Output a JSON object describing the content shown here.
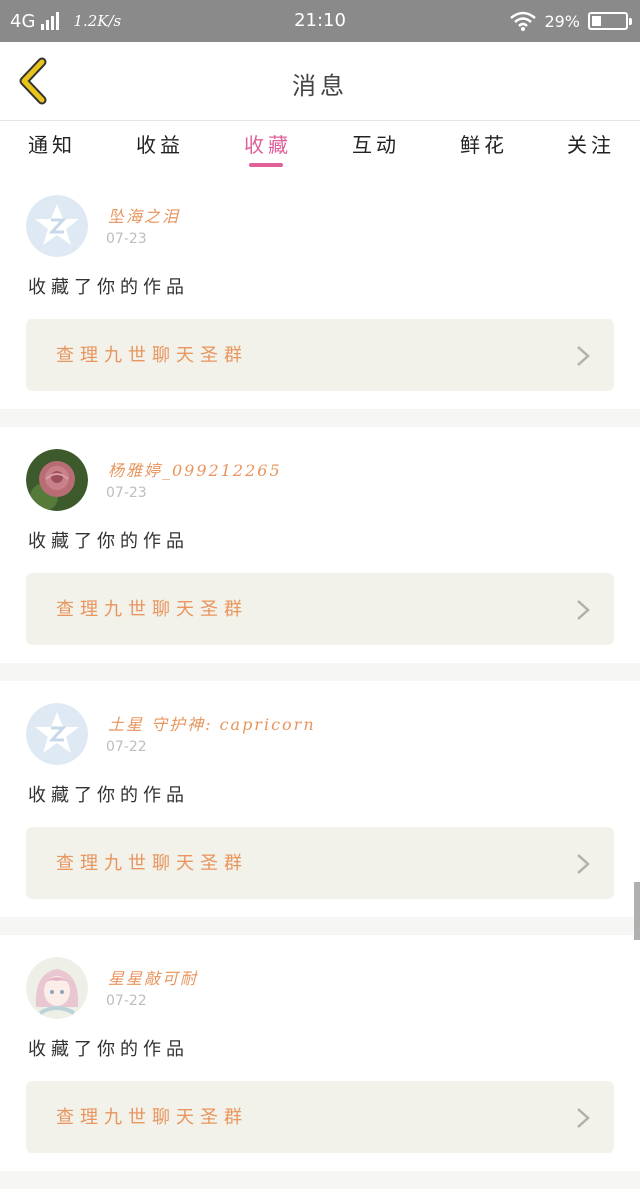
{
  "status_bar": {
    "network": "4G",
    "speed": "1.2K/s",
    "time": "21:10",
    "battery": "29%",
    "battery_level": 0.29
  },
  "header": {
    "title": "消息",
    "back_icon": "chevron-left-icon"
  },
  "tabs": [
    {
      "label": "通知",
      "active": false
    },
    {
      "label": "收益",
      "active": false
    },
    {
      "label": "收藏",
      "active": true
    },
    {
      "label": "互动",
      "active": false
    },
    {
      "label": "鲜花",
      "active": false
    },
    {
      "label": "关注",
      "active": false
    }
  ],
  "messages": [
    {
      "user": "坠海之泪",
      "date": "07-23",
      "action": "收藏了你的作品",
      "work": "查理九世聊天圣群",
      "avatar": "default-qq-avatar"
    },
    {
      "user": "杨雅婷_099212265",
      "date": "07-23",
      "action": "收藏了你的作品",
      "work": "查理九世聊天圣群",
      "avatar": "rose-avatar"
    },
    {
      "user": "土星 守护神: capricorn",
      "date": "07-22",
      "action": "收藏了你的作品",
      "work": "查理九世聊天圣群",
      "avatar": "default-qq-avatar"
    },
    {
      "user": "星星敲可耐",
      "date": "07-22",
      "action": "收藏了你的作品",
      "work": "查理九世聊天圣群",
      "avatar": "anime-girl-avatar"
    }
  ],
  "colors": {
    "accent": "#e0609a",
    "name": "#e8955e",
    "back_arrow": "#e8c31a",
    "card_bg": "#f2f2ea"
  }
}
